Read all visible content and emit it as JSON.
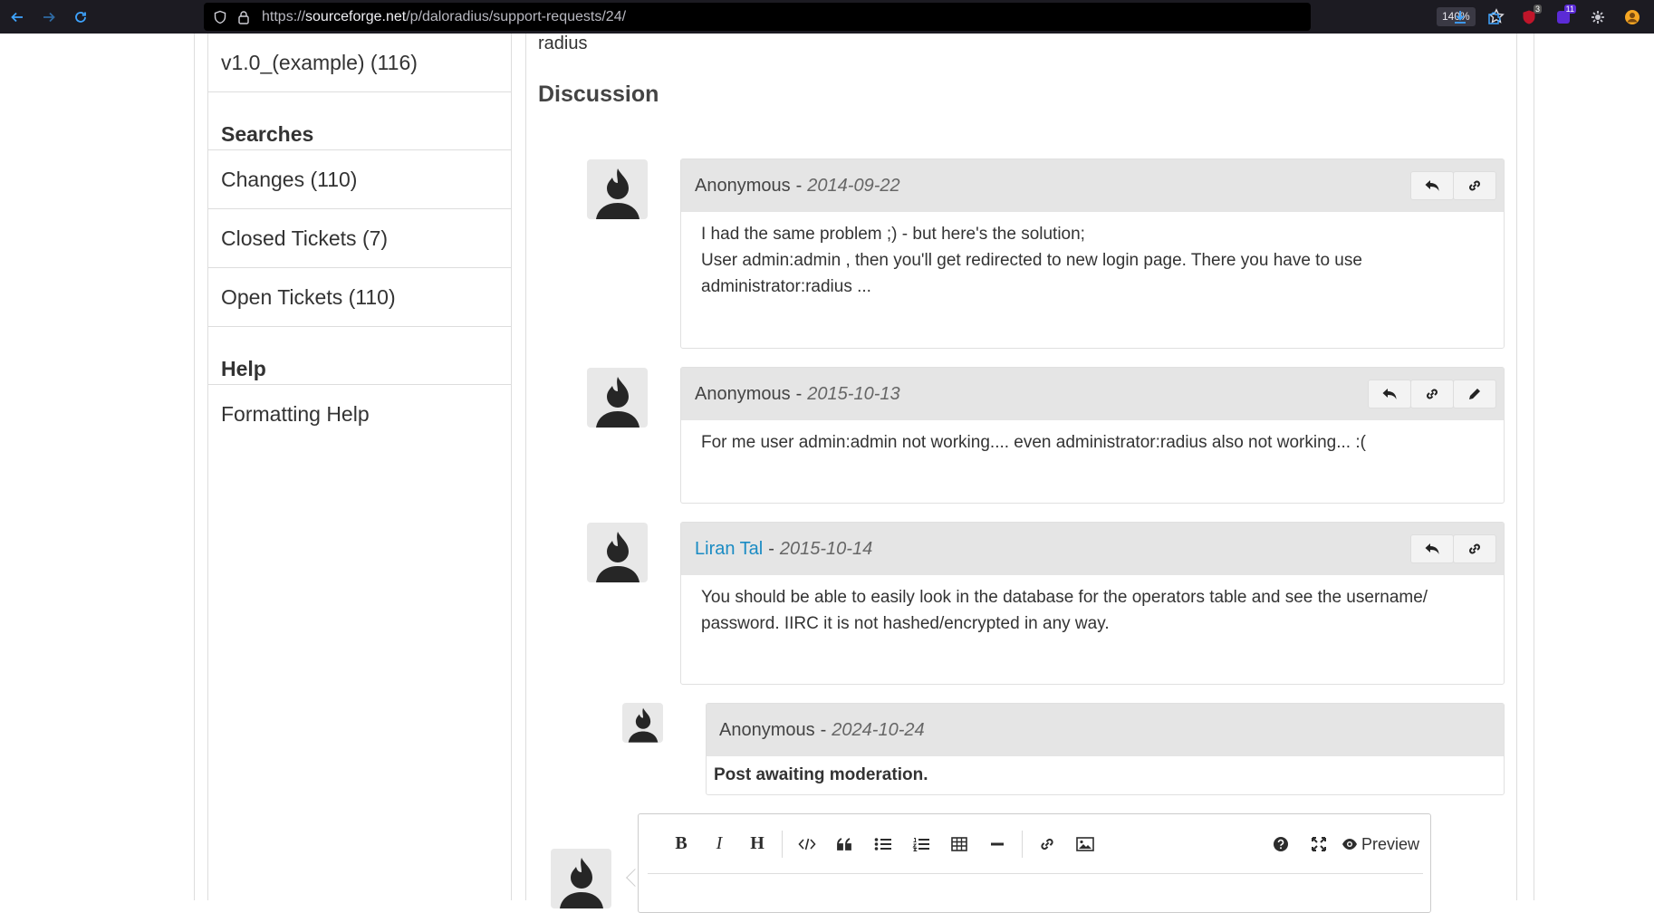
{
  "browser": {
    "url_prefix": "https://",
    "url_host": "sourceforge.net",
    "url_path": "/p/daloradius/support-requests/24/",
    "zoom": "140%",
    "ext_badges": [
      "3",
      "11"
    ]
  },
  "sidebar": {
    "top_item": "v1.0_(example) (116)",
    "searches_heading": "Searches",
    "searches": [
      "Changes (110)",
      "Closed Tickets (7)",
      "Open Tickets (110)"
    ],
    "help_heading": "Help",
    "help_items": [
      "Formatting Help"
    ]
  },
  "main": {
    "top_text": "radius",
    "discussion_title": "Discussion"
  },
  "posts": [
    {
      "author": "Anonymous",
      "date": "2014-09-22",
      "lines": [
        "I had the same problem ;) - but here's the solution;",
        "User admin:admin , then you'll get redirected to new login page. There you have to use",
        "administrator:radius ..."
      ]
    },
    {
      "author": "Anonymous",
      "date": "2015-10-13",
      "lines": [
        "For me user admin:admin not working.... even administrator:radius also not working... :("
      ]
    },
    {
      "author": "Liran Tal",
      "date": "2015-10-14",
      "lines": [
        "You should be able to easily look in the database for the operators table and see the username/",
        "password. IIRC it is not hashed/encrypted in any way."
      ]
    },
    {
      "author": "Anonymous",
      "date": "2024-10-24",
      "lines": [
        "Post awaiting moderation."
      ]
    }
  ],
  "editor": {
    "toolbar": [
      "B",
      "I",
      "H"
    ],
    "preview_label": "Preview"
  },
  "separator": "-"
}
